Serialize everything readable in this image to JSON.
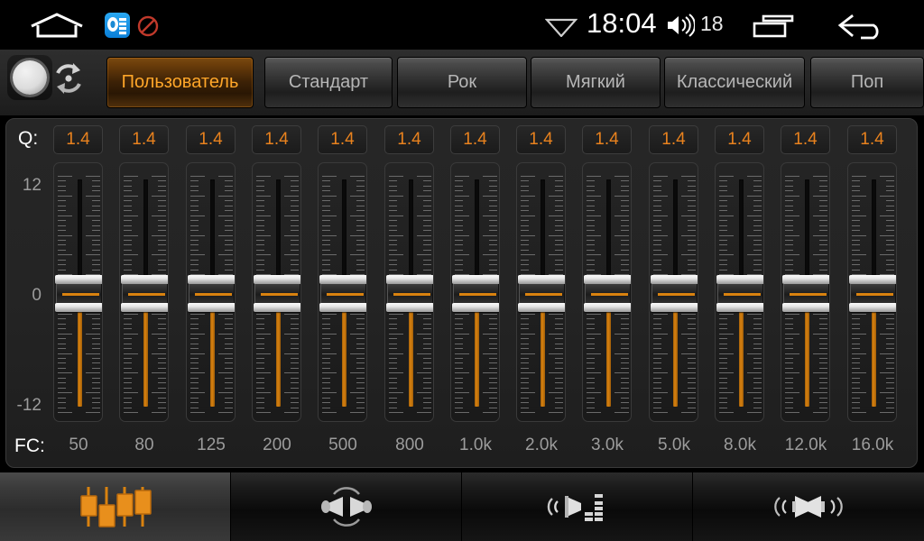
{
  "statusbar": {
    "home_icon": "home-icon",
    "app_icon": "equalizer-app-icon",
    "blocked_icon": "no-entry-icon",
    "wifi_icon": "wifi-icon",
    "time": "18:04",
    "volume_icon": "volume-icon",
    "volume_level": "18",
    "recents_icon": "recent-apps-icon",
    "back_icon": "back-arrow-icon"
  },
  "presetbar": {
    "knob_icon": "rotary-knob-icon",
    "reset_icon": "refresh-reset-icon",
    "presets": [
      {
        "label": "Пользователь",
        "active": true
      },
      {
        "label": "Стандарт",
        "active": false
      },
      {
        "label": "Рок",
        "active": false
      },
      {
        "label": "Мягкий",
        "active": false
      },
      {
        "label": "Классический",
        "active": false
      },
      {
        "label": "Поп",
        "active": false
      }
    ]
  },
  "equalizer": {
    "q_label": "Q:",
    "fc_label": "FC:",
    "db_scale": [
      "12",
      "0",
      "-12"
    ],
    "bands": [
      {
        "q": "1.4",
        "fc": "50",
        "gain_db": 0
      },
      {
        "q": "1.4",
        "fc": "80",
        "gain_db": 0
      },
      {
        "q": "1.4",
        "fc": "125",
        "gain_db": 0
      },
      {
        "q": "1.4",
        "fc": "200",
        "gain_db": 0
      },
      {
        "q": "1.4",
        "fc": "500",
        "gain_db": 0
      },
      {
        "q": "1.4",
        "fc": "800",
        "gain_db": 0
      },
      {
        "q": "1.4",
        "fc": "1.0k",
        "gain_db": 0
      },
      {
        "q": "1.4",
        "fc": "2.0k",
        "gain_db": 0
      },
      {
        "q": "1.4",
        "fc": "3.0k",
        "gain_db": 0
      },
      {
        "q": "1.4",
        "fc": "5.0k",
        "gain_db": 0
      },
      {
        "q": "1.4",
        "fc": "8.0k",
        "gain_db": 0
      },
      {
        "q": "1.4",
        "fc": "12.0k",
        "gain_db": 0
      },
      {
        "q": "1.4",
        "fc": "16.0k",
        "gain_db": 0
      }
    ]
  },
  "tabbar": {
    "tabs": [
      {
        "icon": "equalizer-sliders-icon",
        "active": true
      },
      {
        "icon": "balance-fader-icon",
        "active": false
      },
      {
        "icon": "loudness-levels-icon",
        "active": false
      },
      {
        "icon": "surround-speakers-icon",
        "active": false
      }
    ]
  },
  "colors": {
    "accent": "#e8821e",
    "accent_text": "#ffa629",
    "panel": "#242424",
    "text_muted": "#9c9c9c"
  }
}
